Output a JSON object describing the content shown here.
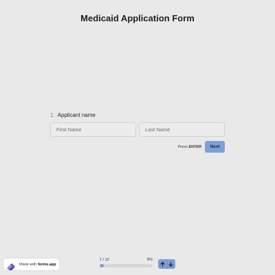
{
  "form": {
    "title": "Medicaid Application Form"
  },
  "question": {
    "number": "1.",
    "label": "Applicant name",
    "first_name_placeholder": "First Name",
    "last_name_placeholder": "Last Name",
    "first_name_value": "",
    "last_name_value": ""
  },
  "actions": {
    "press_prefix": "Press",
    "press_key": "ENTER",
    "next_label": "Next"
  },
  "progress": {
    "step_text": "1 / 12",
    "percent_text": "8%",
    "fraction": 0.08
  },
  "badge": {
    "made_with": "Made with",
    "brand": "forms.app"
  },
  "colors": {
    "accent": "#7f9fd3",
    "background": "#e9e9e9"
  },
  "icons": {
    "up": "arrow-up-icon",
    "down": "arrow-down-icon",
    "logo": "forms-app-logo-icon"
  }
}
